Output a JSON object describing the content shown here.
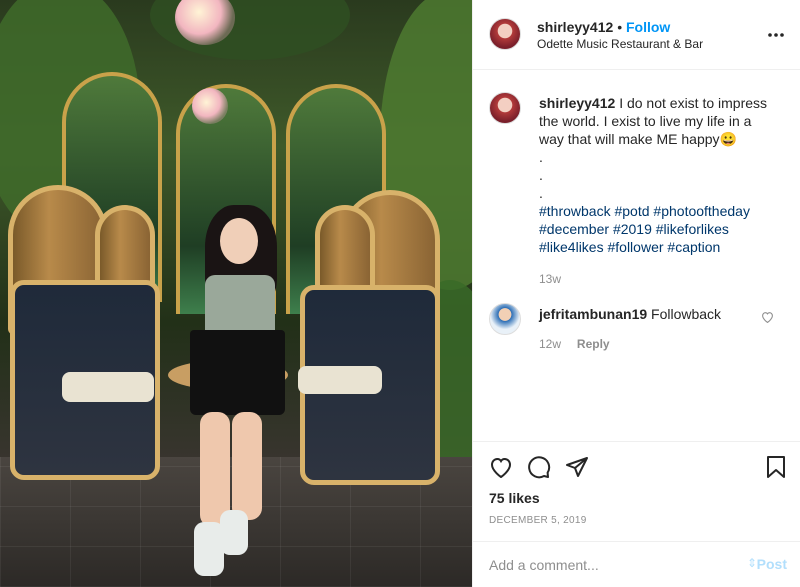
{
  "header": {
    "username": "shirleyy412",
    "separator": "•",
    "follow_label": "Follow",
    "location": "Odette Music Restaurant & Bar",
    "more_icon": "more-horizontal-icon"
  },
  "caption": {
    "username": "shirleyy412",
    "text": "I do not exist to impress the world. I exist to live my life in a way that will make ME happy😀",
    "dots": [
      ".",
      ".",
      "."
    ],
    "hashtags_line1": [
      "#throwback",
      "#potd",
      "#photooftheday"
    ],
    "hashtags_line2": [
      "#december",
      "#2019",
      "#likeforlikes"
    ],
    "hashtags_line3": [
      "#like4likes",
      "#follower",
      "#caption"
    ],
    "time": "13w"
  },
  "comment": {
    "username": "jefritambunan19",
    "text": "Followback",
    "time": "12w",
    "reply_label": "Reply",
    "like_icon": "heart-outline-icon"
  },
  "actions": {
    "like_icon": "heart-icon",
    "comment_icon": "comment-icon",
    "share_icon": "paper-plane-icon",
    "save_icon": "bookmark-icon"
  },
  "stats": {
    "likes": "75 likes",
    "date": "DECEMBER 5, 2019"
  },
  "add_comment": {
    "placeholder": "Add a comment...",
    "post_label": "Post"
  },
  "colors": {
    "link_blue": "#0095f6",
    "hashtag_blue": "#00376b",
    "muted": "#8e8e8e",
    "post_disabled": "#b2dffc"
  }
}
